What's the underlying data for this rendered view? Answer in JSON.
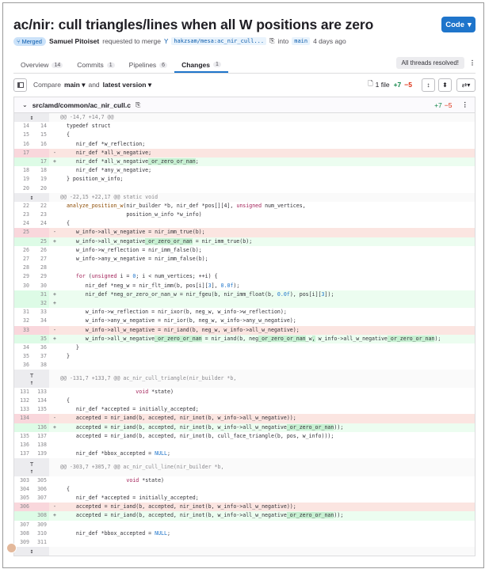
{
  "mr": {
    "title": "ac/nir: cull triangles/lines when all W positions are zero",
    "code_button": "Code",
    "status": "Merged",
    "author": "Samuel Pitoiset",
    "requested_text": "requested to merge",
    "source_branch": "hakzsam/mesa:ac_nir_cull...",
    "into_text": "into",
    "target_branch": "main",
    "time": "4 days ago"
  },
  "tabs": [
    {
      "label": "Overview",
      "count": "14"
    },
    {
      "label": "Commits",
      "count": "1"
    },
    {
      "label": "Pipelines",
      "count": "6"
    },
    {
      "label": "Changes",
      "count": "1"
    }
  ],
  "threads_label": "All threads resolved!",
  "toolbar": {
    "compare": "Compare",
    "base": "main",
    "and": "and",
    "version": "latest version",
    "files": "1 file",
    "additions": "+7",
    "deletions": "−5"
  },
  "file": {
    "path": "src/amd/common/ac_nir_cull.c",
    "additions": "+7",
    "deletions": "−5"
  },
  "diff": [
    {
      "t": "hunk1",
      "code": "@@ -14,7 +14,7 @@"
    },
    {
      "t": "ctx",
      "o": "14",
      "n": "14",
      "code": "  typedef struct"
    },
    {
      "t": "ctx",
      "o": "15",
      "n": "15",
      "code": "  {"
    },
    {
      "t": "ctx",
      "o": "16",
      "n": "16",
      "code": "     nir_def *w_reflection;"
    },
    {
      "t": "del",
      "o": "17",
      "n": "",
      "code": "     nir_def *all_w_negative;"
    },
    {
      "t": "add",
      "o": "",
      "n": "17",
      "segs": [
        [
          "     nir_def *all_w_negative",
          ""
        ],
        [
          "_or_zero_or_nan",
          "h"
        ],
        [
          ";",
          ""
        ]
      ]
    },
    {
      "t": "ctx",
      "o": "18",
      "n": "18",
      "code": "     nir_def *any_w_negative;"
    },
    {
      "t": "ctx",
      "o": "19",
      "n": "19",
      "code": "  } position_w_info;"
    },
    {
      "t": "ctx",
      "o": "20",
      "n": "20",
      "code": ""
    },
    {
      "t": "hunk1",
      "code": "@@ -22,15 +22,17 @@ static void"
    },
    {
      "t": "ctx",
      "o": "22",
      "n": "22",
      "segs": [
        [
          "  ",
          ""
        ],
        [
          "analyze_position_w",
          "f"
        ],
        [
          "(nir_builder *b, nir_def *pos[][4], ",
          ""
        ],
        [
          "unsigned",
          "k"
        ],
        [
          " num_vertices,",
          ""
        ]
      ]
    },
    {
      "t": "ctx",
      "o": "23",
      "n": "23",
      "code": "                     position_w_info *w_info)"
    },
    {
      "t": "ctx",
      "o": "24",
      "n": "24",
      "code": "  {"
    },
    {
      "t": "del",
      "o": "25",
      "n": "",
      "code": "     w_info->all_w_negative = nir_imm_true(b);"
    },
    {
      "t": "add",
      "o": "",
      "n": "25",
      "segs": [
        [
          "     w_info->all_w_negative",
          ""
        ],
        [
          "_or_zero_or_nan",
          "h"
        ],
        [
          " = nir_imm_true(b);",
          ""
        ]
      ]
    },
    {
      "t": "ctx",
      "o": "26",
      "n": "26",
      "code": "     w_info->w_reflection = nir_imm_false(b);"
    },
    {
      "t": "ctx",
      "o": "27",
      "n": "27",
      "code": "     w_info->any_w_negative = nir_imm_false(b);"
    },
    {
      "t": "ctx",
      "o": "28",
      "n": "28",
      "code": ""
    },
    {
      "t": "ctx",
      "o": "29",
      "n": "29",
      "segs": [
        [
          "     ",
          ""
        ],
        [
          "for",
          "k"
        ],
        [
          " (",
          ""
        ],
        [
          "unsigned",
          "k"
        ],
        [
          " i = ",
          ""
        ],
        [
          "0",
          "n"
        ],
        [
          "; i < num_vertices; ++i) {",
          ""
        ]
      ]
    },
    {
      "t": "ctx",
      "o": "30",
      "n": "30",
      "segs": [
        [
          "        nir_def *neg_w = nir_flt_imm(b, pos[i][",
          ""
        ],
        [
          "3",
          "n"
        ],
        [
          "], ",
          ""
        ],
        [
          "0.0f",
          "n"
        ],
        [
          ");",
          ""
        ]
      ]
    },
    {
      "t": "add",
      "o": "",
      "n": "31",
      "segs": [
        [
          "        nir_def *neg_or_zero_or_nan_w = nir_fgeu(b, nir_imm_float(b, ",
          ""
        ],
        [
          "0.0f",
          "n"
        ],
        [
          "), pos[i][",
          ""
        ],
        [
          "3",
          "n"
        ],
        [
          "]);",
          ""
        ]
      ]
    },
    {
      "t": "add",
      "o": "",
      "n": "32",
      "code": ""
    },
    {
      "t": "ctx",
      "o": "31",
      "n": "33",
      "code": "        w_info->w_reflection = nir_ixor(b, neg_w, w_info->w_reflection);"
    },
    {
      "t": "ctx",
      "o": "32",
      "n": "34",
      "code": "        w_info->any_w_negative = nir_ior(b, neg_w, w_info->any_w_negative);"
    },
    {
      "t": "del",
      "o": "33",
      "n": "",
      "code": "        w_info->all_w_negative = nir_iand(b, neg_w, w_info->all_w_negative);"
    },
    {
      "t": "add",
      "o": "",
      "n": "35",
      "segs": [
        [
          "        w_info->all_w_negative",
          ""
        ],
        [
          "_or_zero_or_nan",
          "h"
        ],
        [
          " = nir_iand(b, neg",
          ""
        ],
        [
          "_or_zero_or_nan",
          "h"
        ],
        [
          "_w",
          ""
        ],
        [
          ",",
          "h"
        ],
        [
          " w_info->all_w_negative",
          ""
        ],
        [
          "_or_zero_or_nan",
          "h"
        ],
        [
          ");",
          ""
        ]
      ]
    },
    {
      "t": "ctx",
      "o": "34",
      "n": "36",
      "code": "     }"
    },
    {
      "t": "ctx",
      "o": "35",
      "n": "37",
      "code": "  }"
    },
    {
      "t": "ctx",
      "o": "36",
      "n": "38",
      "code": ""
    },
    {
      "t": "hunk2",
      "code": "@@ -131,7 +133,7 @@ ac_nir_cull_triangle(nir_builder *b,"
    },
    {
      "t": "ctx",
      "o": "131",
      "n": "133",
      "segs": [
        [
          "                        ",
          ""
        ],
        [
          "void",
          "k"
        ],
        [
          " *state)",
          ""
        ]
      ]
    },
    {
      "t": "ctx",
      "o": "132",
      "n": "134",
      "code": "  {"
    },
    {
      "t": "ctx",
      "o": "133",
      "n": "135",
      "segs": [
        [
          "     nir_def *accepted = initially_accepted;",
          ""
        ]
      ]
    },
    {
      "t": "del",
      "o": "134",
      "n": "",
      "code": "     accepted = nir_iand(b, accepted, nir_inot(b, w_info->all_w_negative));"
    },
    {
      "t": "add",
      "o": "",
      "n": "136",
      "segs": [
        [
          "     accepted = nir_iand(b, accepted, nir_inot(b, w_info->all_w_negative",
          ""
        ],
        [
          "_or_zero_or_nan",
          "h"
        ],
        [
          "));",
          ""
        ]
      ]
    },
    {
      "t": "ctx",
      "o": "135",
      "n": "137",
      "code": "     accepted = nir_iand(b, accepted, nir_inot(b, cull_face_triangle(b, pos, w_info)));"
    },
    {
      "t": "ctx",
      "o": "136",
      "n": "138",
      "code": ""
    },
    {
      "t": "ctx",
      "o": "137",
      "n": "139",
      "segs": [
        [
          "     nir_def *bbox_accepted = ",
          ""
        ],
        [
          "NULL",
          "n"
        ],
        [
          ";",
          ""
        ]
      ]
    },
    {
      "t": "hunk2",
      "code": "@@ -303,7 +305,7 @@ ac_nir_cull_line(nir_builder *b,"
    },
    {
      "t": "ctx",
      "o": "303",
      "n": "305",
      "segs": [
        [
          "                     ",
          ""
        ],
        [
          "void",
          "k"
        ],
        [
          " *state)",
          ""
        ]
      ]
    },
    {
      "t": "ctx",
      "o": "304",
      "n": "306",
      "code": "  {"
    },
    {
      "t": "ctx",
      "o": "305",
      "n": "307",
      "code": "     nir_def *accepted = initially_accepted;"
    },
    {
      "t": "del",
      "o": "306",
      "n": "",
      "code": "     accepted = nir_iand(b, accepted, nir_inot(b, w_info->all_w_negative));"
    },
    {
      "t": "add",
      "o": "",
      "n": "308",
      "segs": [
        [
          "     accepted = nir_iand(b, accepted, nir_inot(b, w_info->all_w_negative",
          ""
        ],
        [
          "_or_zero_or_nan",
          "h"
        ],
        [
          "));",
          ""
        ]
      ]
    },
    {
      "t": "ctx",
      "o": "307",
      "n": "309",
      "code": ""
    },
    {
      "t": "ctx",
      "o": "308",
      "n": "310",
      "segs": [
        [
          "     nir_def *bbox_accepted = ",
          ""
        ],
        [
          "NULL",
          "n"
        ],
        [
          ";",
          ""
        ]
      ]
    },
    {
      "t": "ctx",
      "o": "309",
      "n": "311",
      "code": ""
    },
    {
      "t": "hunk1",
      "code": ""
    }
  ]
}
